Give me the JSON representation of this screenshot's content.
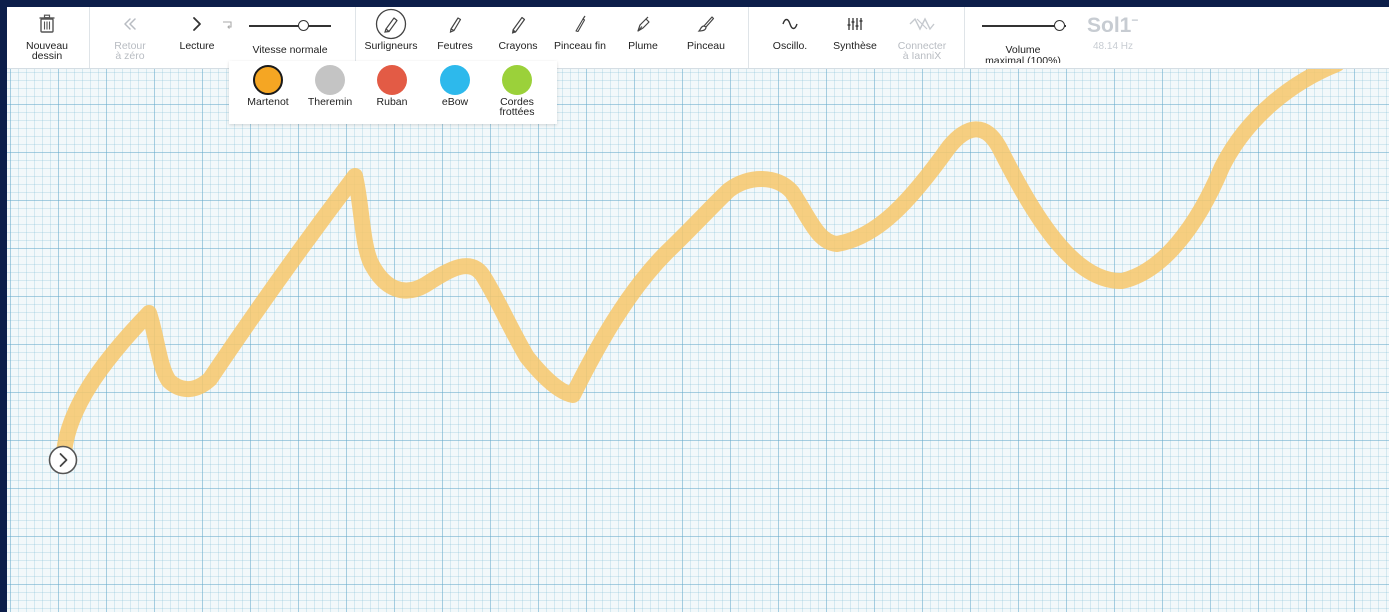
{
  "toolbar": {
    "new_drawing": {
      "label": "Nouveau\ndessin",
      "icon": "trash-icon"
    },
    "rewind": {
      "label": "Retour\nà zéro",
      "icon": "double-chevron-left-icon",
      "enabled": false
    },
    "play": {
      "label": "Lecture",
      "icon": "chevron-right-icon"
    },
    "speed": {
      "label": "Vitesse normale",
      "value": 0.7
    },
    "tools": [
      {
        "label": "Surligneurs",
        "icon": "highlighter-icon",
        "selected": true
      },
      {
        "label": "Feutres",
        "icon": "marker-icon"
      },
      {
        "label": "Crayons",
        "icon": "pencil-icon"
      },
      {
        "label": "Pinceau fin",
        "icon": "fine-brush-icon"
      },
      {
        "label": "Plume",
        "icon": "fountain-pen-icon"
      },
      {
        "label": "Pinceau",
        "icon": "paint-brush-icon"
      }
    ],
    "oscillo": {
      "label": "Oscillo.",
      "icon": "sine-wave-icon"
    },
    "synthese": {
      "label": "Synthèse",
      "icon": "mixer-sliders-icon"
    },
    "connect": {
      "label": "Connecter\nà IanniX",
      "icon": "iannix-icon",
      "enabled": false
    },
    "volume": {
      "label": "Volume\nmaximal (100%)",
      "value": 1.0
    }
  },
  "note": {
    "name": "Sol1",
    "suffix": "−",
    "frequency": "48.14 Hz"
  },
  "instruments": [
    {
      "label": "Martenot",
      "color": "#f5a623",
      "selected": true
    },
    {
      "label": "Theremin",
      "color": "#c4c4c4",
      "selected": false
    },
    {
      "label": "Ruban",
      "color": "#e35b45",
      "selected": false
    },
    {
      "label": "eBow",
      "color": "#2db9ec",
      "selected": false
    },
    {
      "label": "Cordes\nfrottées",
      "color": "#9bd13a",
      "selected": false
    }
  ],
  "stroke": {
    "color": "#f7c76a"
  }
}
